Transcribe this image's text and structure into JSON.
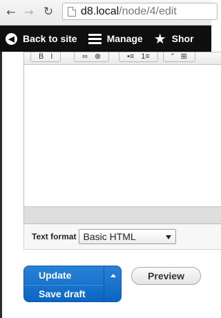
{
  "browser": {
    "url_host": "d8.local",
    "url_path": "/node/4/edit",
    "back_icon": "←",
    "forward_icon": "→",
    "reload_icon": "↻"
  },
  "toolbar": {
    "back_to_site": "Back to site",
    "manage": "Manage",
    "shortcuts": "Shor"
  },
  "editor": {
    "tools": [
      "B",
      "I",
      "∞",
      "⊗",
      "•≡",
      "1≡",
      "”",
      "⊞"
    ]
  },
  "text_format": {
    "label": "Text format",
    "selected": "Basic HTML"
  },
  "actions": {
    "update": "Update",
    "save_draft": "Save draft",
    "preview": "Preview"
  },
  "colors": {
    "primary": "#0a66c2",
    "toolbar_bg": "#0f0f0f"
  }
}
